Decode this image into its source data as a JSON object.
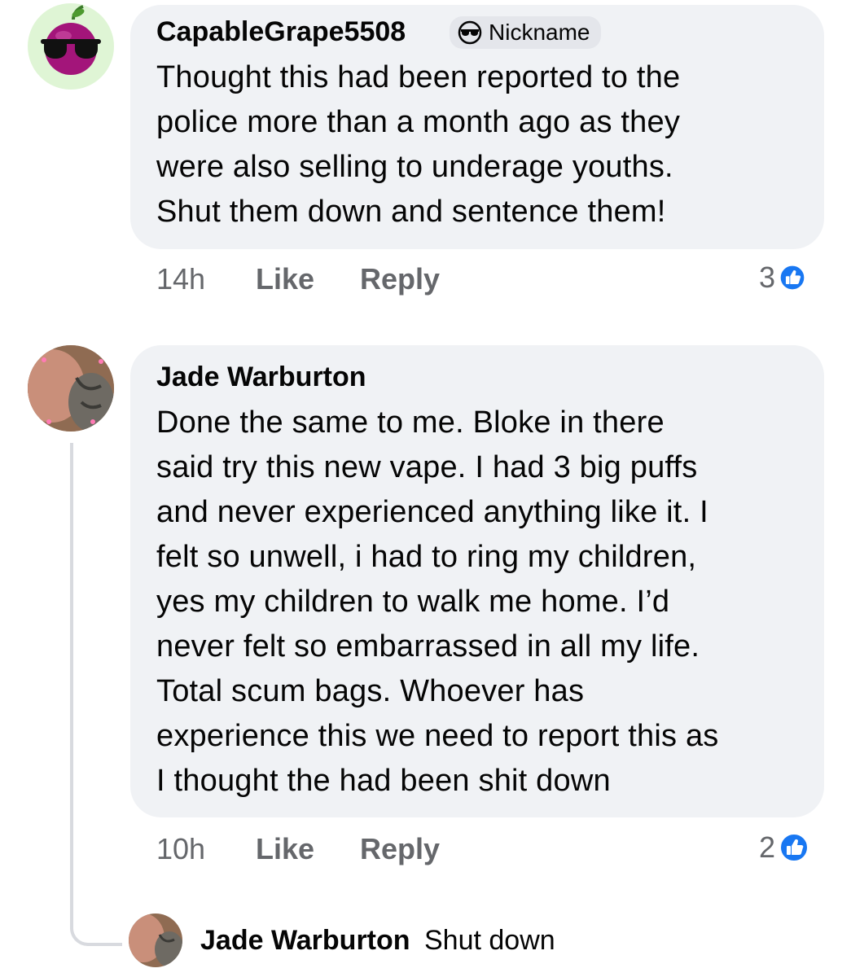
{
  "comments": [
    {
      "author": "CapableGrape5508",
      "badge_label": "Nickname",
      "badge_icon": "sunglasses-icon",
      "body_lines": [
        "Thought this had been reported to the",
        "police more than a month ago as they",
        "were also selling to underage youths.",
        "Shut them down and sentence them!"
      ],
      "time": "14h",
      "like_label": "Like",
      "reply_label": "Reply",
      "reaction_count": "3",
      "avatar": "cherry-sunglasses-avatar"
    },
    {
      "author": "Jade Warburton",
      "body_lines": [
        "Done the same to me. Bloke in there",
        "said try this new vape. I had 3 big puffs",
        "and never experienced anything like it. I",
        "felt so unwell, i had to ring my children,",
        "yes my children to walk me home. I’d",
        "never felt so embarrassed in all my life.",
        "Total scum bags. Whoever has",
        "experience this we need to report this as",
        "I thought the had been shit down"
      ],
      "time": "10h",
      "like_label": "Like",
      "reply_label": "Reply",
      "reaction_count": "2",
      "avatar": "user-photo-avatar"
    }
  ],
  "reply": {
    "author": "Jade Warburton",
    "text": "Shut down",
    "avatar": "user-photo-avatar"
  },
  "colors": {
    "bubble": "#f0f2f5",
    "meta_text": "#65676b",
    "like_blue": "#1877f2",
    "avatar_ring": "#dff5d5"
  }
}
